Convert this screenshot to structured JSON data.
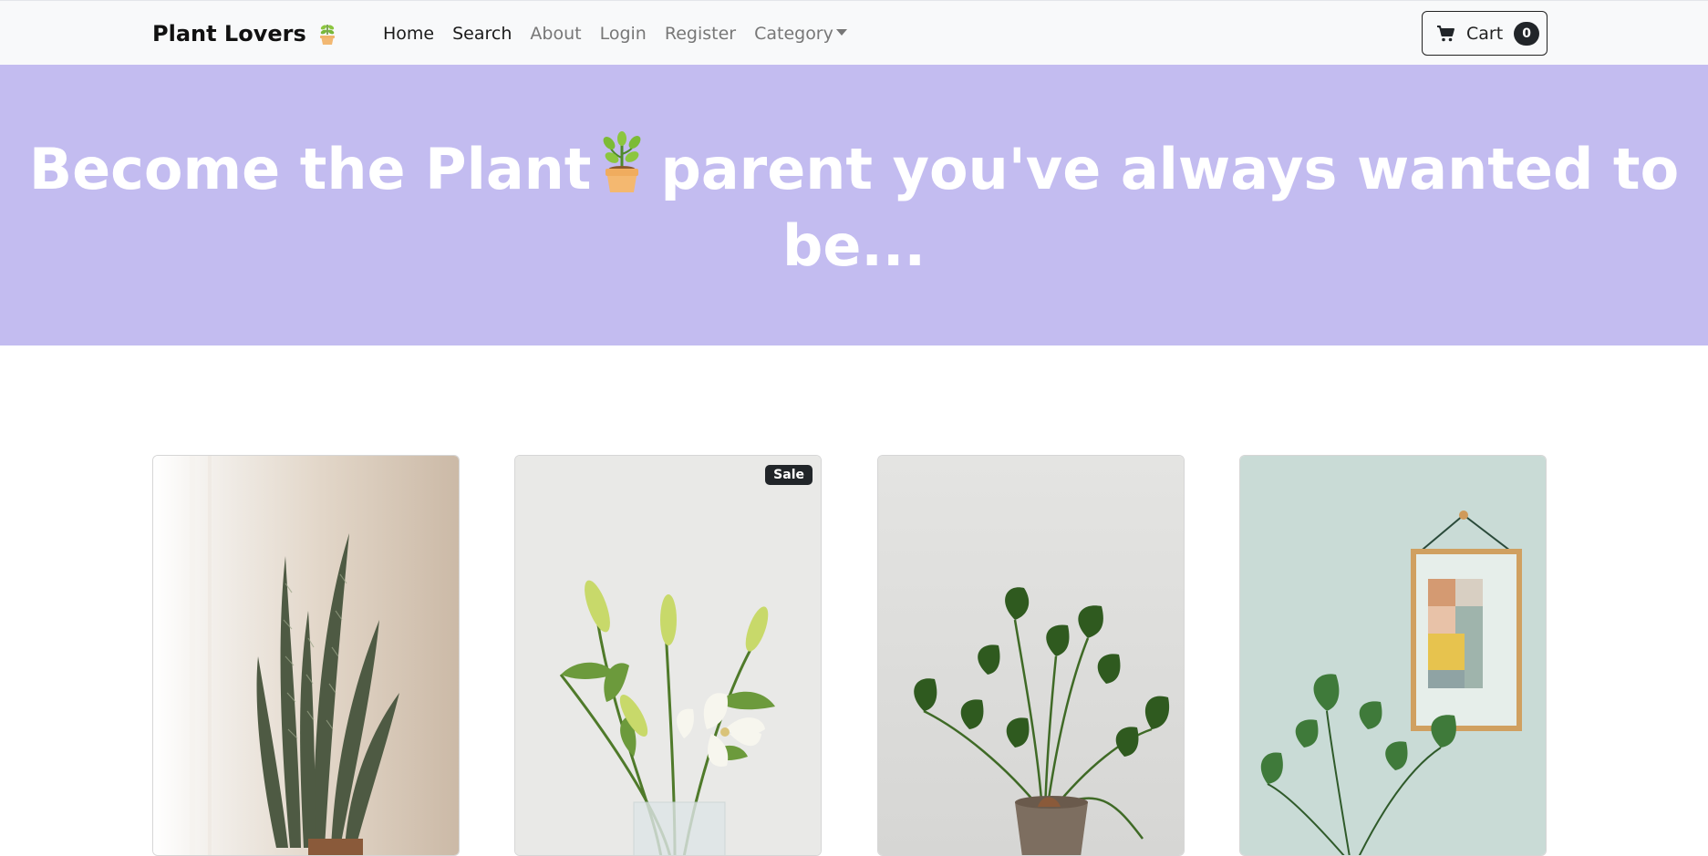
{
  "navbar": {
    "brand": "Plant Lovers",
    "brand_icon": "potted-plant-icon",
    "links": [
      {
        "label": "Home"
      },
      {
        "label": "Search"
      },
      {
        "label": "About"
      },
      {
        "label": "Login"
      },
      {
        "label": "Register"
      },
      {
        "label": "Category"
      }
    ],
    "cart": {
      "label": "Cart",
      "count": "0",
      "icon": "cart-icon"
    }
  },
  "hero": {
    "title_part1": "Become the Plant",
    "title_icon": "potted-plant-icon",
    "title_part2": "parent you've always wanted to be...",
    "background": "#c3bcf0"
  },
  "products": [
    {
      "image": "snake-plant-image",
      "badge": ""
    },
    {
      "image": "lily-bouquet-image",
      "badge": "Sale"
    },
    {
      "image": "potted-philodendron-image",
      "badge": ""
    },
    {
      "image": "monstera-with-frame-image",
      "badge": ""
    }
  ]
}
